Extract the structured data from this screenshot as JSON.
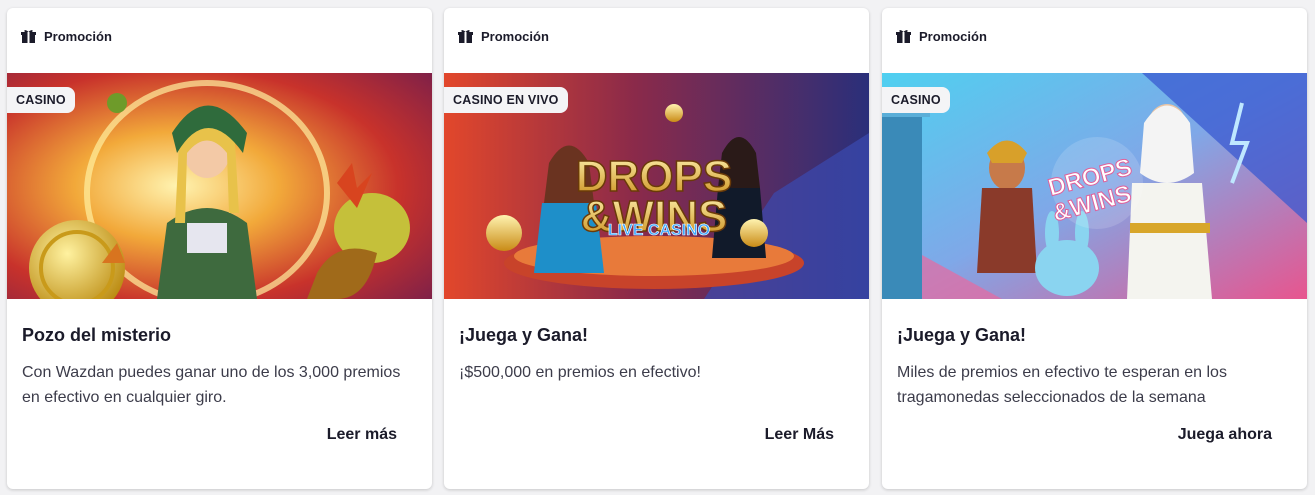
{
  "cards": [
    {
      "header_label": "Promoción",
      "header_icon": "gift-icon",
      "category_tag": "CASINO",
      "title": "Pozo del misterio",
      "description": "Con Wazdan puedes ganar uno de los 3,000 premios en efectivo en cualquier giro.",
      "cta_label": "Leer más",
      "banner_colors": [
        "#e9b93a",
        "#c8322b",
        "#7a1f4a"
      ]
    },
    {
      "header_label": "Promoción",
      "header_icon": "gift-icon",
      "category_tag": "CASINO EN VIVO",
      "title": "¡Juega y Gana!",
      "description": "¡$500,000 en premios en efectivo!",
      "cta_label": "Leer Más",
      "banner_text_1": "DROPS",
      "banner_text_2": "&WINS",
      "banner_text_3": "LIVE CASINO",
      "banner_colors": [
        "#d63b2b",
        "#3a2a7a",
        "#2a3a8a"
      ]
    },
    {
      "header_label": "Promoción",
      "header_icon": "gift-icon",
      "category_tag": "CASINO",
      "title": "¡Juega y Gana!",
      "description": "Miles de premios en efectivo te esperan en los tragamonedas seleccionados de la semana",
      "cta_label": "Juega ahora",
      "banner_text_1": "DROPS",
      "banner_text_2": "&WINS",
      "banner_colors": [
        "#2fb6e6",
        "#e8558e",
        "#3a5ad0"
      ]
    }
  ]
}
